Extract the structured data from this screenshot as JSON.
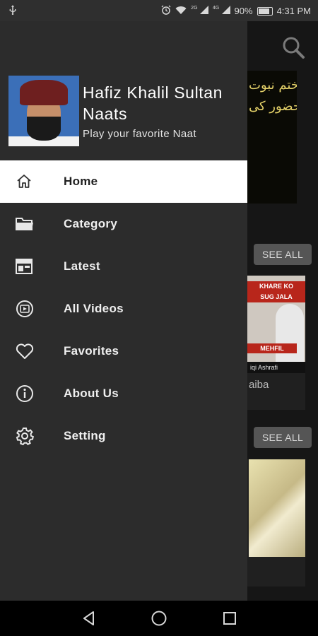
{
  "status_bar": {
    "battery": "90%",
    "time": "4:31 PM",
    "net_badge_1": "2G",
    "net_badge_2": "4G"
  },
  "background": {
    "banner_text": "ختم نبوت حضور کی",
    "see_all_1": "SEE ALL",
    "see_all_2": "SEE ALL",
    "card1": {
      "thumb_line1": "KHARE KO",
      "thumb_line2": "SUG JALA",
      "thumb_line3": "MEHFIL",
      "thumb_caption": "iqi Ashrafi",
      "title": "aiba"
    }
  },
  "drawer": {
    "title": "Hafiz Khalil Sultan Naats",
    "subtitle": "Play your favorite Naat",
    "menu": [
      {
        "label": "Home",
        "icon": "home-icon",
        "active": true
      },
      {
        "label": "Category",
        "icon": "folder-icon",
        "active": false
      },
      {
        "label": "Latest",
        "icon": "latest-icon",
        "active": false
      },
      {
        "label": "All Videos",
        "icon": "video-icon",
        "active": false
      },
      {
        "label": "Favorites",
        "icon": "heart-icon",
        "active": false
      },
      {
        "label": "About Us",
        "icon": "info-icon",
        "active": false
      },
      {
        "label": "Setting",
        "icon": "gear-icon",
        "active": false
      }
    ]
  },
  "colors": {
    "drawer_bg": "#2c2c2c",
    "active_bg": "#ffffff",
    "status_bar_bg": "#2f2f2f",
    "see_all_bg": "#555555"
  }
}
